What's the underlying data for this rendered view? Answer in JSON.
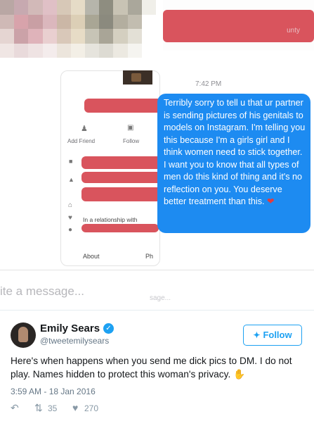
{
  "screenshot": {
    "top_banner": {
      "brand_fragment": "unty"
    },
    "profile_card": {
      "add_friend": "Add Friend",
      "follow": "Follow",
      "relationship": "In a relationship with",
      "about_tab": "About",
      "photos_tab_fragment": "Ph"
    },
    "message": {
      "time": "7:42 PM",
      "text": "Terribly sorry to tell u that ur partner is sending pictures of his genitals to models on Instagram. I'm telling you this because I'm a girls girl and I think women need to stick together. I want you to know that all types of men do this kind of thing and it's no reflection on you. You deserve better treatment than this.",
      "emoji": "❤"
    },
    "composer": {
      "placeholder_fragment": "ite a message...",
      "placeholder_fragment_small": "sage..."
    }
  },
  "tweet": {
    "author_name": "Emily Sears",
    "handle": "@tweetemilysears",
    "follow_label": "Follow",
    "text": "Here's when happens when you send me dick pics to DM. I do not play. Names hidden to protect this woman's privacy. ✋",
    "timestamp": "3:59 AM - 18 Jan 2016",
    "retweets": "35",
    "likes": "270"
  },
  "colors": {
    "bubble": "#1d8bf1",
    "redaction": "#d9545d",
    "twitter_blue": "#1da1f2"
  },
  "icons": [
    "add-friend-icon",
    "follow-icon",
    "briefcase-icon",
    "education-icon",
    "home-icon",
    "heart-icon",
    "location-icon",
    "verified-icon",
    "twitter-bird-icon",
    "reply-icon",
    "retweet-icon",
    "like-icon"
  ]
}
